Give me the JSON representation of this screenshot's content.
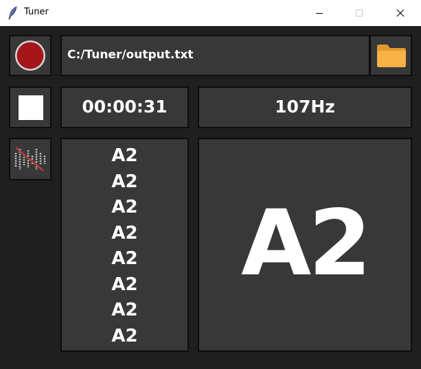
{
  "window": {
    "title": "Tuner",
    "icon": "feather-icon",
    "controls": [
      "minimize-icon",
      "maximize-icon",
      "close-icon"
    ]
  },
  "toolbar": {
    "record_icon": "record-icon",
    "output_path": "C:/Tuner/output.txt",
    "folder_icon": "folder-icon",
    "stop_icon": "stop-icon",
    "waveform_icon": "waveform-muted-icon"
  },
  "status": {
    "elapsed_time": "00:00:31",
    "frequency": "107Hz"
  },
  "notes": {
    "history": [
      "A2",
      "A2",
      "A2",
      "A2",
      "A2",
      "A2",
      "A2",
      "A2"
    ],
    "current": "A2"
  },
  "colors": {
    "background": "#1f1f1f",
    "panel": "#383838",
    "panel_border": "#0c0c0c",
    "text": "#ffffff",
    "record_red": "#a4161a",
    "folder_orange": "#f6b244"
  }
}
